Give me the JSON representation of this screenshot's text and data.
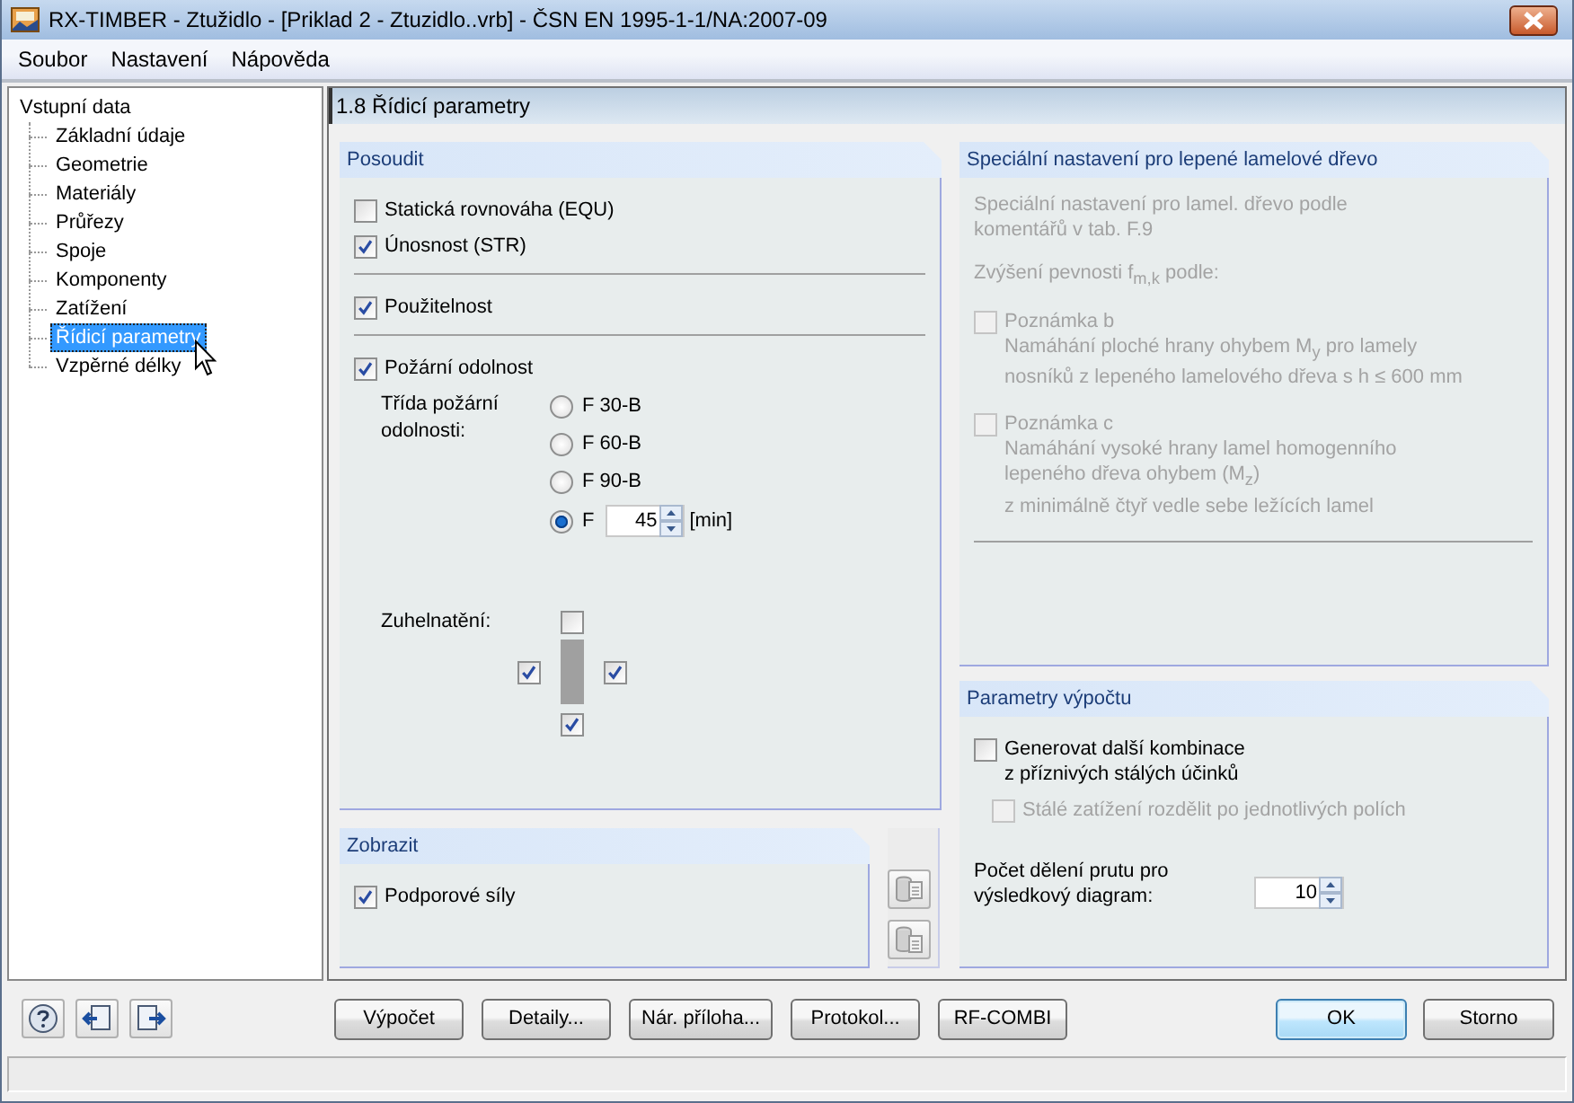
{
  "window": {
    "title": "RX-TIMBER - Ztužidlo - [Priklad 2 - Ztuzidlo..vrb] - ČSN EN 1995-1-1/NA:2007-09"
  },
  "menu": [
    {
      "label": "Soubor"
    },
    {
      "label": "Nastavení"
    },
    {
      "label": "Nápověda"
    }
  ],
  "tree": {
    "label": "Vstupní data",
    "children": [
      {
        "label": "Základní údaje",
        "selected": false
      },
      {
        "label": "Geometrie",
        "selected": false
      },
      {
        "label": "Materiály",
        "selected": false
      },
      {
        "label": "Průřezy",
        "selected": false
      },
      {
        "label": "Spoje",
        "selected": false
      },
      {
        "label": "Komponenty",
        "selected": false
      },
      {
        "label": "Zatížení",
        "selected": false
      },
      {
        "label": "Řídicí parametry",
        "selected": true
      },
      {
        "label": "Vzpěrné délky",
        "selected": false
      }
    ]
  },
  "panel_title": "1.8 Řídicí parametry",
  "assess": {
    "title": "Posoudit",
    "sections": [
      {
        "checks": [
          {
            "label": "Statická rovnováha (EQU)",
            "checked": false
          },
          {
            "label": "Únosnost (STR)",
            "checked": true
          }
        ]
      },
      {
        "checks": [
          {
            "label": "Použitelnost",
            "checked": true
          }
        ]
      },
      {
        "checks": [
          {
            "label": "Požární odolnost",
            "checked": true
          }
        ]
      }
    ],
    "fire_class": {
      "label": "Třída požární\nodolnosti:",
      "options": [
        {
          "kind": "preset",
          "label": "F 30-B",
          "selected": false
        },
        {
          "kind": "preset",
          "label": "F 60-B",
          "selected": false
        },
        {
          "kind": "preset",
          "label": "F 90-B",
          "selected": false
        },
        {
          "kind": "custom",
          "label": "F",
          "value": "45",
          "unit": "[min]",
          "selected": true
        }
      ]
    },
    "charring": {
      "label": "Zuhelnatění:",
      "sides": [
        {
          "kind": "top",
          "checked": false
        },
        {
          "kind": "left",
          "checked": true
        },
        {
          "kind": "right",
          "checked": true
        },
        {
          "kind": "bottom",
          "checked": true
        }
      ]
    }
  },
  "display": {
    "title": "Zobrazit",
    "checks": [
      {
        "label": "Podporové síly",
        "checked": true
      }
    ]
  },
  "glulam": {
    "title": "Speciální nastavení pro lepené lamelové dřevo",
    "disabled": true,
    "intro": "Speciální nastavení pro lamel. dřevo podle\nkomentářů v tab. F.9",
    "increase": "Zvýšení pevnosti f$_{m,k}$ podle:",
    "notes": [
      {
        "label": "Poznámka b",
        "checked": false,
        "text": "Namáhání ploché hrany ohybem M$_{y}$ pro lamely\nnosníků z lepeného lamelového dřeva s h ≤ 600 mm"
      },
      {
        "label": "Poznámka c",
        "checked": false,
        "text": "Namáhání vysoké hrany lamel homogenního\nlepeného dřeva ohybem (M$_{z}$)\nz minimálně čtyř vedle sebe ležících lamel"
      }
    ]
  },
  "calc": {
    "title": "Parametry výpočtu",
    "checks": [
      {
        "kind": "main",
        "label": "Generovat další kombinace\nz příznivých stálých účinků",
        "checked": false,
        "disabled": false
      },
      {
        "kind": "sub",
        "label": "Stálé zatížení rozdělit po jednotlivých polích",
        "checked": false,
        "disabled": true
      }
    ],
    "division": {
      "label": "Počet dělení prutu pro\nvýsledkový diagram:",
      "value": "10"
    }
  },
  "buttons": [
    {
      "label": "Výpočet"
    },
    {
      "label": "Detaily..."
    },
    {
      "label": "Nár. příloha..."
    },
    {
      "label": "Protokol..."
    },
    {
      "label": "RF-COMBI"
    }
  ],
  "dialog_buttons": [
    {
      "label": "OK",
      "default": true
    },
    {
      "label": "Storno",
      "default": false
    }
  ]
}
